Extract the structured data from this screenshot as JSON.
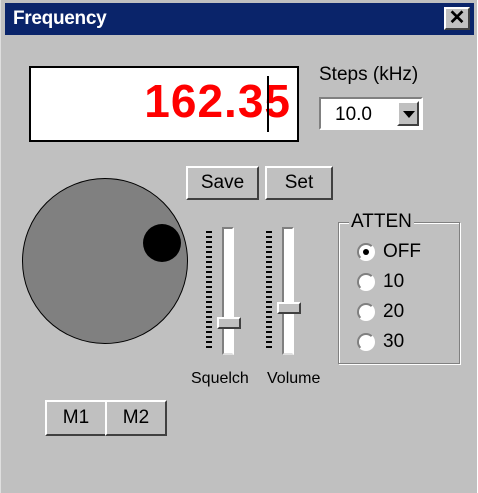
{
  "window": {
    "title": "Frequency",
    "close_symbol": "✕"
  },
  "frequency": {
    "display_value": "162.35",
    "color": "#ff0000"
  },
  "steps": {
    "label": "Steps (kHz)",
    "selected": "10.0"
  },
  "buttons": {
    "save": "Save",
    "set": "Set",
    "m1": "M1",
    "m2": "M2"
  },
  "sliders": {
    "squelch": {
      "label": "Squelch",
      "level": 0.22
    },
    "volume": {
      "label": "Volume",
      "level": 0.35
    }
  },
  "atten": {
    "legend": "ATTEN",
    "options": [
      {
        "label": "OFF",
        "selected": true
      },
      {
        "label": "10",
        "selected": false
      },
      {
        "label": "20",
        "selected": false
      },
      {
        "label": "30",
        "selected": false
      }
    ]
  },
  "colors": {
    "face": "#c0c0c0",
    "title_bar": "#0a246a",
    "knob": "#808080"
  }
}
